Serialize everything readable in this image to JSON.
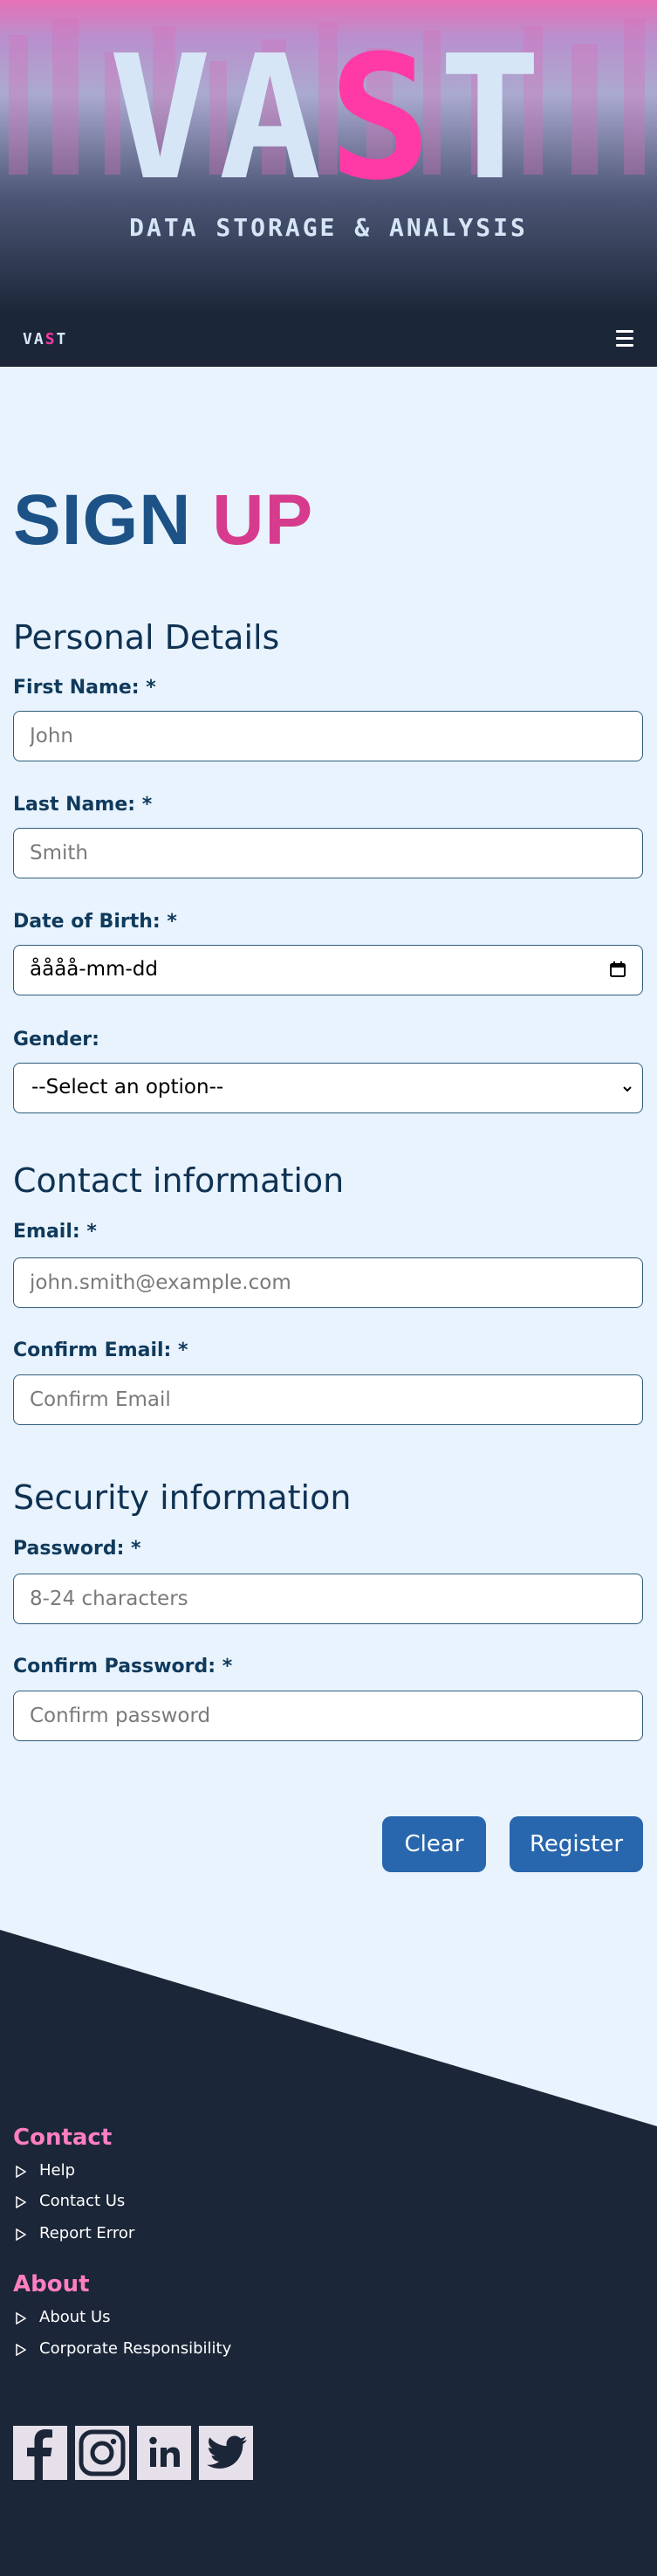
{
  "brand": {
    "hero_letters_1": "VA",
    "hero_letters_2": "S",
    "hero_letters_3": "T",
    "tagline": "DATA STORAGE & ANALYSIS",
    "nav_letters_1": "VA",
    "nav_letters_2": "S",
    "nav_letters_3": "T"
  },
  "page": {
    "title_part1": "SIGN",
    "title_part2": "UP"
  },
  "sections": {
    "personal": "Personal Details",
    "contact": "Contact information",
    "security": "Security information"
  },
  "fields": {
    "first_name": {
      "label": "First Name: *",
      "placeholder": "John"
    },
    "last_name": {
      "label": "Last Name: *",
      "placeholder": "Smith"
    },
    "dob": {
      "label": "Date of Birth: *",
      "value": "åååå-mm-dd"
    },
    "gender": {
      "label": "Gender:",
      "value": "--Select an option--"
    },
    "email": {
      "label": "Email: *",
      "placeholder": "john.smith@example.com"
    },
    "confirm_email": {
      "label": "Confirm Email: *",
      "placeholder": "Confirm Email"
    },
    "password": {
      "label": "Password: *",
      "placeholder": "8-24 characters"
    },
    "confirm_password": {
      "label": "Confirm Password: *",
      "placeholder": "Confirm password"
    }
  },
  "buttons": {
    "clear": "Clear",
    "register": "Register"
  },
  "footer": {
    "contact_heading": "Contact",
    "contact_links": [
      "Help",
      "Contact Us",
      "Report Error"
    ],
    "about_heading": "About",
    "about_links": [
      "About Us",
      "Corporate Responsibility"
    ]
  },
  "icons": {
    "menu": "hamburger-icon",
    "calendar": "calendar-icon",
    "select": "chevron-down-icon",
    "link_bullet": "triangle-right-icon",
    "social": [
      "facebook-icon",
      "instagram-icon",
      "linkedin-icon",
      "twitter-icon"
    ]
  },
  "colors": {
    "accent_pink": "#ff3aa6",
    "title_blue": "#1d5286",
    "title_pink": "#d63b8d",
    "button_blue": "#2867ad",
    "navy": "#1b2638",
    "page_bg": "#e8f3fd",
    "footer_heading_pink": "#ff7ec2"
  }
}
